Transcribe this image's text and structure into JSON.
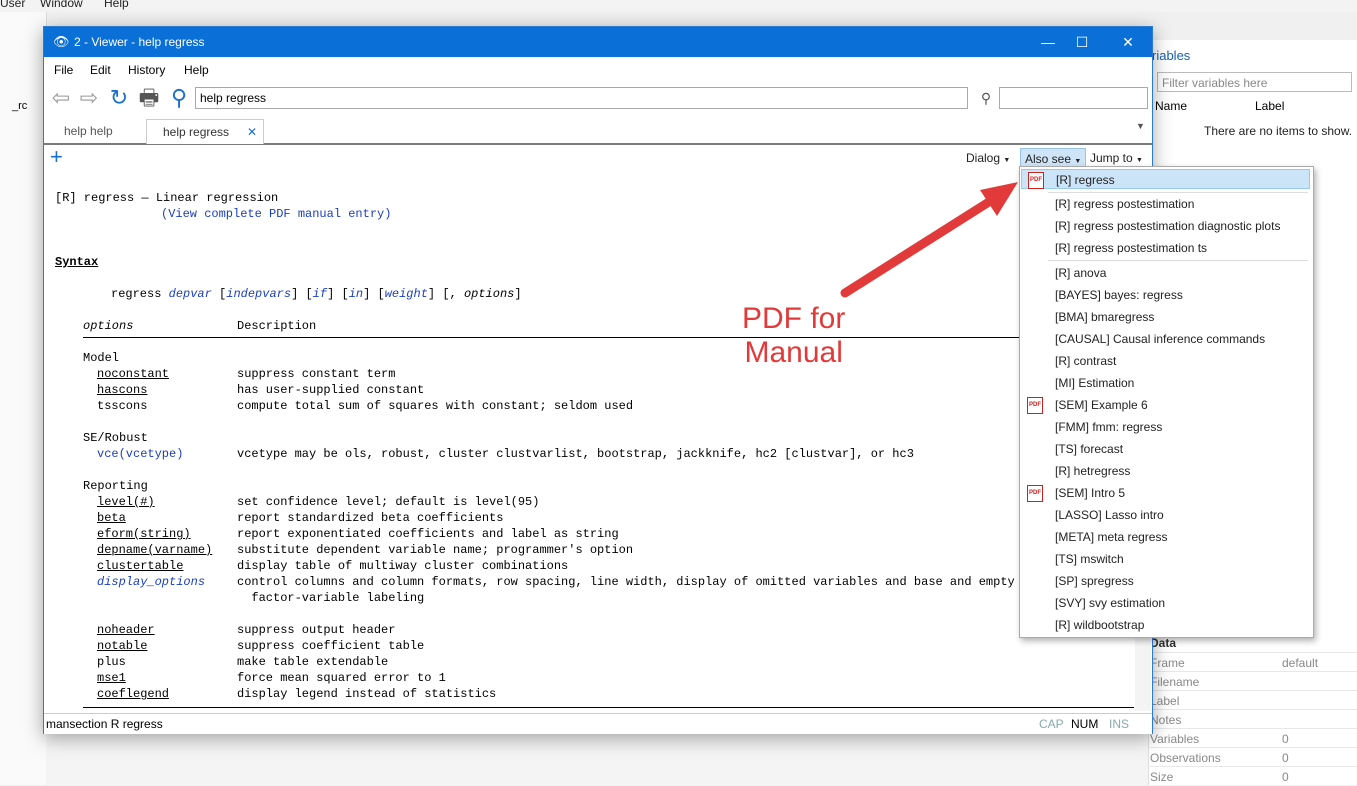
{
  "background": {
    "menu": [
      "User",
      "Window",
      "Help"
    ],
    "left_fragment": "_rc",
    "variables_panel": {
      "title": "riables",
      "filter_placeholder": "Filter variables here",
      "columns": [
        "Name",
        "Label"
      ],
      "empty_text": "There are no items to show."
    },
    "properties": {
      "section": "Data",
      "rows": [
        {
          "name": "Frame",
          "value": "default"
        },
        {
          "name": "Filename",
          "value": ""
        },
        {
          "name": "Label",
          "value": ""
        },
        {
          "name": "Notes",
          "value": ""
        },
        {
          "name": "Variables",
          "value": "0"
        },
        {
          "name": "Observations",
          "value": "0"
        },
        {
          "name": "Size",
          "value": "0"
        }
      ]
    }
  },
  "window": {
    "title": "2 - Viewer - help regress",
    "menu": [
      "File",
      "Edit",
      "History",
      "Help"
    ],
    "command": "help regress",
    "find_value": "",
    "tabs": [
      {
        "label": "help help",
        "active": false
      },
      {
        "label": "help regress",
        "active": true
      }
    ],
    "controls": {
      "dialog": "Dialog",
      "also_see": "Also see",
      "jump_to": "Jump to"
    },
    "status": {
      "left": "mansection R regress",
      "cap": "CAP",
      "num": "NUM",
      "ins": "INS"
    }
  },
  "help": {
    "header_prefix": "[R] regress",
    "header_dash": "—",
    "header_title": "Linear regression",
    "pdf_link": "(View complete PDF manual entry)",
    "syntax_heading": "Syntax",
    "syntax_cmd": "regress",
    "syntax_depvar": "depvar",
    "syntax_rest_1": "[",
    "syntax_indepvars": "indepvars",
    "syntax_rest_2": "] [",
    "syntax_if": "if",
    "syntax_rest_3": "] [",
    "syntax_in": "in",
    "syntax_rest_4": "] [",
    "syntax_weight": "weight",
    "syntax_rest_5": "] [, ",
    "syntax_options": "options",
    "syntax_rest_6": "]",
    "col_options": "options",
    "col_description": "Description",
    "groups": {
      "model": "Model",
      "se": "SE/Robust",
      "reporting": "Reporting"
    },
    "rows": [
      {
        "opt": "noconstant",
        "desc": "suppress constant term"
      },
      {
        "opt": "hascons",
        "desc": "has user-supplied constant"
      },
      {
        "opt": "tsscons",
        "desc": "compute total sum of squares with constant; seldom used"
      },
      {
        "opt": "vce(vcetype)",
        "desc": "vcetype may be ols, robust, cluster clustvarlist, bootstrap, jackknife, hc2 [clustvar], or hc3"
      },
      {
        "opt": "level(#)",
        "desc": "set confidence level; default is level(95)"
      },
      {
        "opt": "beta",
        "desc": "report standardized beta coefficients"
      },
      {
        "opt": "eform(string)",
        "desc": "report exponentiated coefficients and label as string"
      },
      {
        "opt": "depname(varname)",
        "desc": "substitute dependent variable name; programmer's option"
      },
      {
        "opt": "clustertable",
        "desc": "display table of multiway cluster combinations"
      },
      {
        "opt": "display_options",
        "desc": "control columns and column formats, row spacing, line width, display of omitted variables and base and empty cel"
      },
      {
        "opt": "",
        "desc": "  factor-variable labeling"
      },
      {
        "opt": "noheader",
        "desc": "suppress output header"
      },
      {
        "opt": "notable",
        "desc": "suppress coefficient table"
      },
      {
        "opt": "plus",
        "desc": "make table extendable"
      },
      {
        "opt": "mse1",
        "desc": "force mean squared error to 1"
      },
      {
        "opt": "coeflegend",
        "desc": "display legend instead of statistics"
      }
    ]
  },
  "also_see_menu": [
    {
      "label": "[R] regress",
      "pdf": true
    },
    {
      "label": "[R] regress postestimation",
      "pdf": false
    },
    {
      "label": "[R] regress postestimation diagnostic plots",
      "pdf": false
    },
    {
      "label": "[R] regress postestimation ts",
      "pdf": false
    },
    {
      "label": "[R] anova",
      "pdf": false
    },
    {
      "label": "[BAYES] bayes: regress",
      "pdf": false
    },
    {
      "label": "[BMA] bmaregress",
      "pdf": false
    },
    {
      "label": "[CAUSAL] Causal inference commands",
      "pdf": false
    },
    {
      "label": "[R] contrast",
      "pdf": false
    },
    {
      "label": "[MI] Estimation",
      "pdf": false
    },
    {
      "label": "[SEM] Example 6",
      "pdf": true
    },
    {
      "label": "[FMM] fmm: regress",
      "pdf": false
    },
    {
      "label": "[TS] forecast",
      "pdf": false
    },
    {
      "label": "[R] hetregress",
      "pdf": false
    },
    {
      "label": "[SEM] Intro 5",
      "pdf": true
    },
    {
      "label": "[LASSO] Lasso intro",
      "pdf": false
    },
    {
      "label": "[META] meta regress",
      "pdf": false
    },
    {
      "label": "[TS] mswitch",
      "pdf": false
    },
    {
      "label": "[SP] spregress",
      "pdf": false
    },
    {
      "label": "[SVY] svy estimation",
      "pdf": false
    },
    {
      "label": "[R] wildbootstrap",
      "pdf": false
    }
  ],
  "annotation": {
    "line1": "PDF for",
    "line2": "Manual",
    "color": "#e23a3a"
  },
  "colors": {
    "titlebar": "#0b6fd8",
    "link": "#1a3fbf",
    "highlight": "#cce4f7"
  }
}
